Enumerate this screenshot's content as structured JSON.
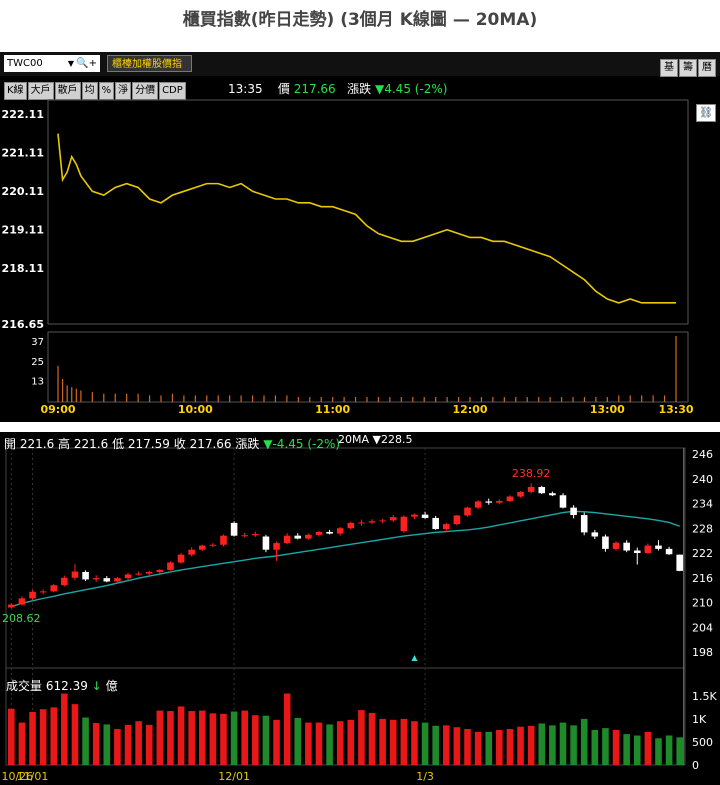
{
  "title": "櫃買指數(昨日走勢) (3個月 K線圖  — 20MA)",
  "intraday": {
    "symbol": "TWC00",
    "symbol_name": "櫃檯加權股價指",
    "right_buttons": [
      "基",
      "籌",
      "曆"
    ],
    "tabs": [
      "K線",
      "大戶",
      "散戶",
      "均",
      "%",
      "淨",
      "分價",
      "CDP"
    ],
    "time": "13:35",
    "price_label": "價",
    "price": "217.66",
    "change_label": "漲跌",
    "change": "▼4.45 (-2%)",
    "link_icon": "link-icon",
    "colors": {
      "price_line": "#e8c900",
      "axis_label": "#ffffff",
      "time_label": "#ffd400",
      "volume": "#d2691e"
    }
  },
  "chart_data": [
    {
      "type": "line",
      "title": "",
      "ylim": [
        216.65,
        222.11
      ],
      "yticks": [
        "222.11",
        "221.11",
        "220.11",
        "219.11",
        "218.11",
        "216.65"
      ],
      "xticks": [
        "09:00",
        "10:00",
        "11:00",
        "12:00",
        "13:00",
        "13:30"
      ],
      "x_minutes": [
        0,
        2,
        4,
        6,
        8,
        10,
        15,
        20,
        25,
        30,
        35,
        40,
        45,
        50,
        55,
        60,
        65,
        70,
        75,
        80,
        85,
        90,
        95,
        100,
        105,
        110,
        115,
        120,
        125,
        130,
        135,
        140,
        145,
        150,
        155,
        160,
        165,
        170,
        175,
        180,
        185,
        190,
        195,
        200,
        205,
        210,
        215,
        220,
        225,
        230,
        235,
        240,
        245,
        250,
        255,
        260,
        265,
        270
      ],
      "values": [
        221.6,
        220.4,
        220.6,
        221.0,
        220.8,
        220.5,
        220.1,
        220.0,
        220.2,
        220.3,
        220.2,
        219.9,
        219.8,
        220.0,
        220.1,
        220.2,
        220.3,
        220.3,
        220.2,
        220.3,
        220.1,
        220.0,
        219.9,
        219.9,
        219.8,
        219.8,
        219.7,
        219.7,
        219.6,
        219.5,
        219.2,
        219.0,
        218.9,
        218.8,
        218.8,
        218.9,
        219.0,
        219.1,
        219.0,
        218.9,
        218.9,
        218.8,
        218.8,
        218.7,
        218.6,
        218.5,
        218.4,
        218.2,
        218.0,
        217.8,
        217.5,
        217.3,
        217.2,
        217.3,
        217.2,
        217.2,
        217.2,
        217.2
      ]
    },
    {
      "type": "bar",
      "title": "",
      "ylim": [
        0,
        40
      ],
      "yticks": [
        "37",
        "25",
        "13"
      ],
      "x_minutes": [
        0,
        2,
        4,
        6,
        8,
        10,
        15,
        20,
        25,
        30,
        35,
        40,
        45,
        50,
        55,
        60,
        65,
        70,
        75,
        80,
        85,
        90,
        95,
        100,
        105,
        110,
        115,
        120,
        125,
        130,
        135,
        140,
        145,
        150,
        155,
        160,
        165,
        170,
        175,
        180,
        185,
        190,
        195,
        200,
        205,
        210,
        215,
        220,
        225,
        230,
        235,
        240,
        245,
        250,
        255,
        260,
        265,
        270
      ],
      "values": [
        22,
        14,
        10,
        9,
        8,
        7,
        6,
        5,
        5,
        5,
        5,
        4,
        4,
        5,
        4,
        4,
        4,
        4,
        4,
        4,
        4,
        4,
        4,
        4,
        3,
        3,
        3,
        3,
        3,
        3,
        3,
        3,
        3,
        3,
        3,
        3,
        3,
        3,
        3,
        3,
        3,
        3,
        3,
        3,
        3,
        3,
        3,
        3,
        3,
        3,
        3,
        3,
        4,
        4,
        4,
        4,
        4,
        40
      ]
    },
    {
      "type": "candlestick",
      "title": "",
      "ohlc_text": {
        "open_label": "開",
        "open": "221.6",
        "high_label": "高",
        "high": "221.6",
        "low_label": "低",
        "low": "217.59",
        "close_label": "收",
        "close": "217.66",
        "change_label": "漲跌",
        "change": "▼-4.45 (-2%)"
      },
      "ma_label": "20MA",
      "ma_value": "▼228.5",
      "ylim": [
        198,
        246
      ],
      "yticks": [
        "246",
        "240",
        "234",
        "228",
        "222",
        "216",
        "210",
        "204",
        "198"
      ],
      "xticks": [
        "10/26",
        "11/01",
        "12/01",
        "1/3"
      ],
      "annotations": [
        "238.92",
        "208.62"
      ],
      "colors": {
        "up": "#ff2020",
        "down": "#ffffff",
        "ma": "#1aa7a7"
      },
      "candles": [
        [
          208.8,
          209.8,
          208.62,
          209.5
        ],
        [
          209.5,
          211.5,
          209.3,
          211.0
        ],
        [
          211.0,
          213.0,
          210.6,
          212.6
        ],
        [
          212.6,
          213.2,
          212.0,
          212.7
        ],
        [
          212.7,
          214.5,
          212.5,
          214.2
        ],
        [
          214.2,
          216.5,
          213.9,
          216.0
        ],
        [
          216.0,
          219.3,
          215.4,
          217.5
        ],
        [
          217.4,
          217.8,
          215.2,
          215.6
        ],
        [
          215.6,
          216.6,
          215.0,
          215.9
        ],
        [
          215.9,
          216.4,
          214.9,
          215.1
        ],
        [
          215.1,
          216.2,
          214.9,
          215.9
        ],
        [
          215.9,
          217.2,
          215.4,
          216.8
        ],
        [
          216.8,
          217.5,
          216.5,
          217.0
        ],
        [
          217.0,
          217.7,
          216.6,
          217.4
        ],
        [
          217.4,
          218.1,
          217.0,
          217.9
        ],
        [
          217.9,
          220.0,
          217.7,
          219.7
        ],
        [
          219.7,
          222.0,
          219.4,
          221.6
        ],
        [
          221.6,
          223.4,
          221.2,
          222.8
        ],
        [
          222.8,
          224.0,
          222.5,
          223.8
        ],
        [
          223.8,
          224.4,
          223.4,
          224.0
        ],
        [
          224.0,
          226.5,
          223.6,
          226.2
        ],
        [
          229.3,
          229.7,
          226.0,
          226.2
        ],
        [
          226.2,
          226.9,
          225.8,
          226.3
        ],
        [
          226.3,
          227.2,
          225.9,
          226.6
        ],
        [
          226.0,
          226.4,
          222.2,
          222.8
        ],
        [
          222.8,
          224.8,
          220.1,
          224.4
        ],
        [
          224.4,
          226.8,
          224.1,
          226.2
        ],
        [
          226.2,
          226.8,
          225.3,
          225.5
        ],
        [
          225.5,
          226.7,
          225.2,
          226.4
        ],
        [
          226.4,
          227.4,
          226.0,
          227.1
        ],
        [
          227.1,
          227.6,
          226.5,
          226.7
        ],
        [
          226.7,
          228.3,
          226.2,
          228.0
        ],
        [
          228.0,
          229.6,
          227.7,
          229.3
        ],
        [
          229.3,
          230.1,
          228.6,
          229.4
        ],
        [
          229.4,
          230.2,
          229.0,
          229.7
        ],
        [
          229.7,
          230.3,
          229.2,
          229.9
        ],
        [
          229.9,
          231.2,
          229.5,
          230.7
        ],
        [
          227.3,
          231.1,
          226.9,
          230.8
        ],
        [
          230.8,
          231.6,
          230.2,
          231.3
        ],
        [
          231.3,
          232.0,
          230.3,
          230.5
        ],
        [
          230.5,
          231.0,
          227.6,
          227.8
        ],
        [
          227.8,
          229.3,
          227.1,
          229.0
        ],
        [
          229.0,
          231.2,
          228.7,
          231.1
        ],
        [
          231.1,
          233.2,
          230.8,
          233.0
        ],
        [
          233.0,
          234.8,
          232.6,
          234.5
        ],
        [
          234.5,
          235.2,
          233.7,
          234.2
        ],
        [
          234.2,
          235.0,
          233.8,
          234.6
        ],
        [
          234.6,
          236.0,
          234.3,
          235.7
        ],
        [
          235.7,
          237.0,
          235.4,
          236.8
        ],
        [
          236.8,
          238.92,
          236.4,
          238.0
        ],
        [
          238.0,
          238.3,
          236.3,
          236.5
        ],
        [
          236.5,
          236.9,
          235.8,
          236.0
        ],
        [
          236.0,
          236.5,
          232.8,
          233.0
        ],
        [
          233.0,
          233.6,
          230.4,
          231.2
        ],
        [
          231.2,
          231.8,
          226.3,
          227.0
        ],
        [
          227.0,
          227.6,
          225.4,
          226.0
        ],
        [
          226.0,
          226.5,
          222.3,
          223.0
        ],
        [
          223.0,
          224.8,
          222.6,
          224.5
        ],
        [
          224.5,
          225.1,
          222.2,
          222.6
        ],
        [
          222.6,
          223.3,
          219.2,
          222.0
        ],
        [
          222.0,
          224.3,
          221.8,
          223.8
        ],
        [
          223.8,
          225.1,
          222.6,
          223.0
        ],
        [
          223.0,
          223.5,
          221.5,
          221.7
        ],
        [
          221.6,
          221.6,
          217.59,
          217.66
        ]
      ],
      "ma": [
        209.0,
        209.8,
        210.4,
        211.0,
        211.5,
        212.1,
        212.6,
        213.1,
        213.6,
        214.1,
        214.7,
        215.3,
        215.9,
        216.4,
        216.9,
        217.4,
        217.9,
        218.3,
        218.7,
        219.1,
        219.5,
        219.9,
        220.3,
        220.7,
        221.0,
        221.3,
        221.7,
        222.1,
        222.5,
        222.9,
        223.3,
        223.7,
        224.1,
        224.5,
        224.9,
        225.3,
        225.7,
        226.1,
        226.4,
        226.7,
        227.0,
        227.2,
        227.4,
        227.6,
        227.9,
        228.3,
        228.8,
        229.3,
        229.8,
        230.3,
        230.8,
        231.3,
        231.8,
        232.1,
        232.0,
        231.8,
        231.5,
        231.2,
        230.9,
        230.6,
        230.3,
        229.9,
        229.4,
        228.5
      ]
    },
    {
      "type": "bar",
      "title": "",
      "volume_label": "成交量",
      "volume_value": "612.39",
      "volume_arrow": "↓",
      "volume_unit": "億",
      "ylim": [
        0,
        1800
      ],
      "yticks": [
        "1.5K",
        "1K",
        "500",
        "0"
      ],
      "values": [
        1220,
        920,
        1150,
        1210,
        1250,
        1550,
        1320,
        1030,
        910,
        880,
        780,
        870,
        950,
        870,
        1180,
        1170,
        1270,
        1170,
        1180,
        1120,
        1110,
        1160,
        1180,
        1080,
        1070,
        980,
        1550,
        1020,
        920,
        920,
        880,
        950,
        980,
        1190,
        1130,
        1000,
        980,
        1000,
        950,
        920,
        850,
        860,
        820,
        780,
        720,
        720,
        760,
        780,
        830,
        850,
        900,
        860,
        920,
        860,
        1000,
        760,
        800,
        760,
        670,
        640,
        720,
        580,
        640,
        600
      ]
    }
  ]
}
